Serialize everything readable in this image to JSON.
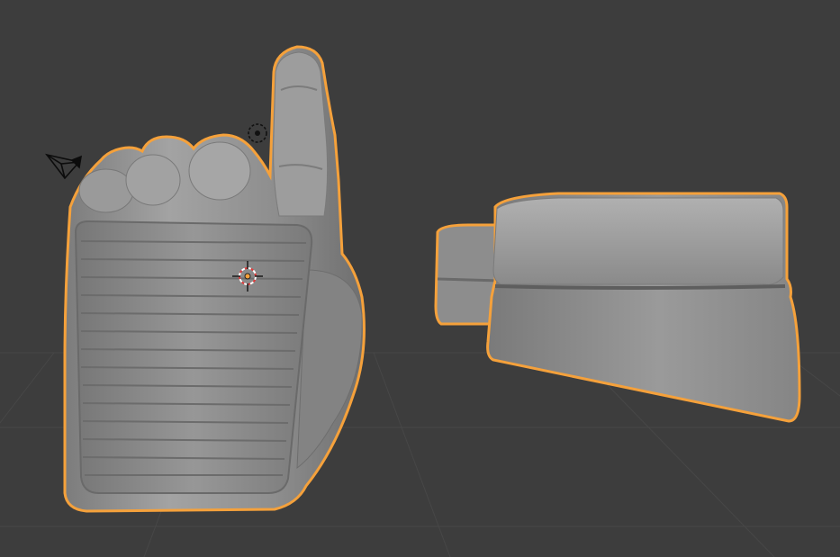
{
  "viewport": {
    "background_color": "#3d3d3d",
    "grid_color": "#474747",
    "selection_outline_color": "#f5a13b",
    "mesh_base_color": "#8f8f8f",
    "objects": [
      {
        "name": "hand",
        "selected": true
      },
      {
        "name": "band-ring",
        "selected": true
      }
    ],
    "gizmos": [
      "camera-icon",
      "light-icon",
      "object-origin-icon",
      "3d-cursor-icon"
    ]
  }
}
